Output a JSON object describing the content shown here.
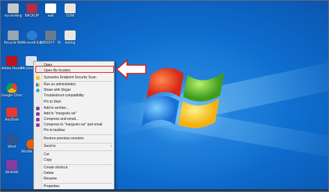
{
  "desktop_icons": [
    {
      "label": "my working",
      "color": "#c8c8c8"
    },
    {
      "label": "BACKUP",
      "color": "#b0304a"
    },
    {
      "label": "wall",
      "color": "#ffffff"
    },
    {
      "label": "GSM",
      "color": "#e8e8e0"
    },
    {
      "label": "Recycle Bin",
      "color": "#9aa5b0"
    },
    {
      "label": "Microsoft Edge",
      "color": "#2a7bd1"
    },
    {
      "label": "HRSOFT - Shortcut",
      "color": "#6a7a90"
    },
    {
      "label": "testing",
      "color": "#e8e8e0"
    },
    {
      "label": "Adobe Reader XI",
      "color": "#c0131b"
    },
    {
      "label": "Microsoft OneDrive",
      "color": "#d9e6f2"
    },
    {
      "label": "Google Chrome",
      "color": "#3aa655"
    },
    {
      "label": "AnyDesk",
      "color": "#e23b32"
    },
    {
      "label": "Word",
      "color": "#2b5797"
    },
    {
      "label": "WinRAR",
      "color": "#8a3aa0"
    },
    {
      "label": "Mozilla Firefox",
      "color": "#e66000"
    }
  ],
  "context_menu": {
    "items": [
      {
        "label": "Open",
        "icon": "none"
      },
      {
        "label": "Open file location",
        "icon": "none"
      },
      {
        "label": "Symantec Endpoint Security Scan",
        "icon": "shield-icon"
      },
      {
        "label": "Run as administrator",
        "icon": "admin-shield-icon"
      },
      {
        "label": "Share with Skype",
        "icon": "skype-icon"
      },
      {
        "label": "Troubleshoot compatibility",
        "icon": "none"
      },
      {
        "label": "Pin to Start",
        "icon": "none"
      },
      {
        "label": "Add to archive...",
        "icon": "winrar-icon"
      },
      {
        "label": "Add to \"margovin.rar\"",
        "icon": "winrar-icon"
      },
      {
        "label": "Compress and email...",
        "icon": "winrar-icon"
      },
      {
        "label": "Compress to \"margovin.rar\" and email",
        "icon": "winrar-icon"
      },
      {
        "label": "Pin to taskbar",
        "icon": "none"
      },
      {
        "label": "Restore previous versions",
        "icon": "none"
      },
      {
        "label": "Send to",
        "icon": "none"
      },
      {
        "label": "Cut",
        "icon": "none"
      },
      {
        "label": "Copy",
        "icon": "none"
      },
      {
        "label": "Create shortcut",
        "icon": "none"
      },
      {
        "label": "Delete",
        "icon": "none"
      },
      {
        "label": "Rename",
        "icon": "none"
      },
      {
        "label": "Properties",
        "icon": "none"
      }
    ],
    "submenu_arrow": "›"
  },
  "colors": {
    "highlight": "#d81e1e",
    "accent_icon_blue": "#2a7bd1",
    "accent_icon_purple": "#8a3aa0"
  }
}
